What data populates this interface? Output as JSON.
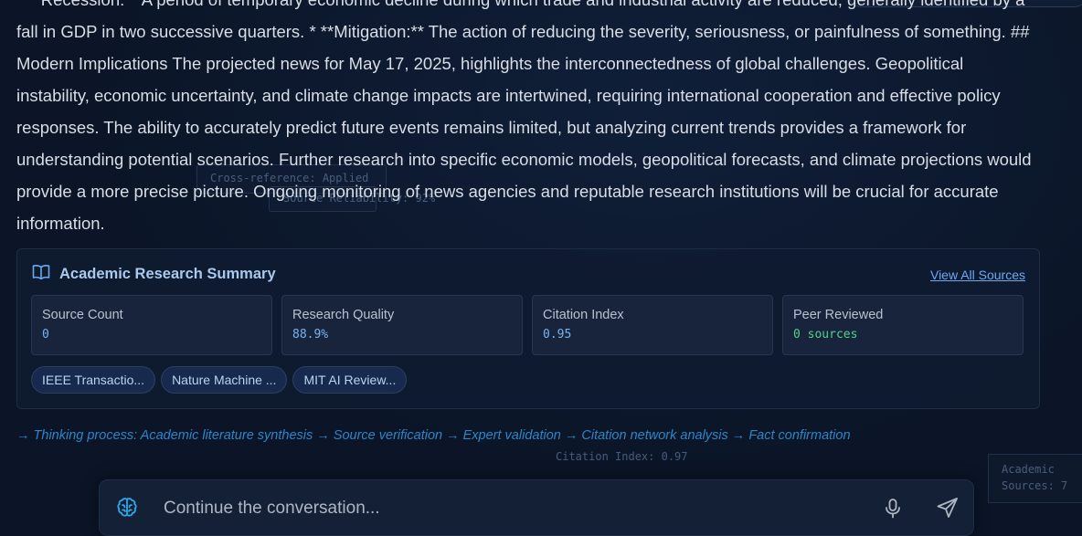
{
  "message": {
    "text": "* **Recession:** A period of temporary economic decline during which trade and industrial activity are reduced, generally identified by a fall in GDP in two successive quarters. * **Mitigation:** The action of reducing the severity, seriousness, or painfulness of something. ## Modern Implications The projected news for May 17, 2025, highlights the interconnectedness of global challenges. Geopolitical instability, economic uncertainty, and climate change impacts are intertwined, requiring international cooperation and effective policy responses. The ability to accurately predict future events remains limited, but analyzing current trends provides a framework for understanding potential scenarios. Further research into specific economic models, geopolitical forecasts, and climate projections would provide a more precise picture. Ongoing monitoring of news agencies and reputable research institutions will be crucial for accurate information."
  },
  "floating": {
    "cross_reference": "Cross-reference: Applied",
    "source_reliability": "Source Reliability: 92%",
    "citation_index": "Citation Index: 0.97",
    "academic": "Academic",
    "sources": "Sources: 7"
  },
  "research": {
    "title": "Academic Research Summary",
    "view_all": "View All Sources",
    "stats": [
      {
        "label": "Source Count",
        "value": "0"
      },
      {
        "label": "Research Quality",
        "value": "88.9%"
      },
      {
        "label": "Citation Index",
        "value": "0.95"
      },
      {
        "label": "Peer Reviewed",
        "value": "0 sources"
      }
    ],
    "chips": [
      "IEEE Transactio...",
      "Nature Machine ...",
      "MIT AI Review..."
    ]
  },
  "thinking": "→ Thinking process: Academic literature synthesis → Source verification → Expert validation → Citation network analysis → Fact confirmation",
  "composer": {
    "placeholder": "Continue the conversation..."
  },
  "icons": {
    "brain": "brain-icon",
    "book": "book-icon",
    "mic": "mic-icon",
    "send": "send-icon"
  },
  "colors": {
    "accent": "#6ea9f0",
    "green": "#4fd38b",
    "thinking": "#2d86c8",
    "brain": "#2fa8e8"
  }
}
